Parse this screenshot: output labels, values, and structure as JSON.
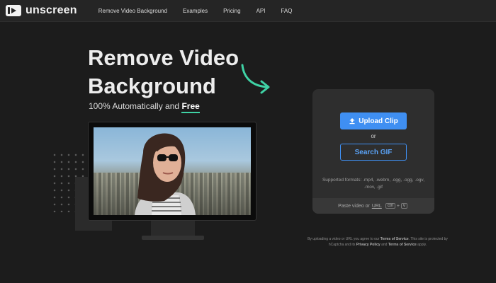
{
  "nav": {
    "brand": "unscreen",
    "links": [
      "Remove Video Background",
      "Examples",
      "Pricing",
      "API",
      "FAQ"
    ]
  },
  "hero": {
    "title": "Remove Video Background",
    "subtitle_prefix": "100% Automatically and",
    "subtitle_highlight": "Free"
  },
  "upload": {
    "upload_label": "Upload Clip",
    "or_label": "or",
    "search_label": "Search GIF",
    "formats": "Supported formats: .mp4, .webm, .ogg, .ogg, .ogv, .mov, .gif",
    "paste_prefix": "Paste video or",
    "paste_url": "URL",
    "key_ctrl": "ctrl",
    "key_plus": "+",
    "key_v": "v"
  },
  "terms": {
    "line1_prefix": "By uploading a video or URL you agree to our",
    "terms_link": "Terms of Service",
    "line1_suffix": ". This site is protected",
    "line2_prefix": "by hCaptcha and its",
    "privacy_link": "Privacy Policy",
    "line2_mid": "and",
    "tos_link": "Terms of Service",
    "line2_suffix": "apply."
  },
  "colors": {
    "accent_blue": "#3f8ff2",
    "accent_green": "#3fd2a5",
    "background": "#1c1c1c"
  }
}
